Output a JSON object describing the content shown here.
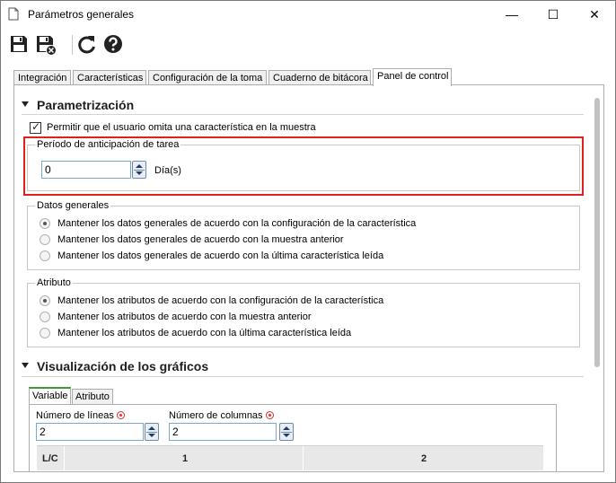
{
  "window": {
    "title": "Parámetros generales",
    "controls": {
      "minimize": "—",
      "maximize": "☐",
      "close": "✕"
    }
  },
  "toolbar": {
    "buttons": [
      {
        "name": "save",
        "icon": "floppy-disk-icon"
      },
      {
        "name": "save-and-close",
        "icon": "floppy-disk-close-icon"
      },
      {
        "name": "refresh",
        "icon": "refresh-icon"
      },
      {
        "name": "help",
        "icon": "help-icon"
      }
    ]
  },
  "tabs": [
    {
      "label": "Integración"
    },
    {
      "label": "Características"
    },
    {
      "label": "Configuración de la toma"
    },
    {
      "label": "Cuaderno de bitácora"
    },
    {
      "label": "Panel de control",
      "active": true
    }
  ],
  "parametrizacion": {
    "title": "Parametrización",
    "allow_omit": {
      "label": "Permitir que el usuario omita una característica en la muestra",
      "checked": true
    },
    "periodo": {
      "legend": "Período de anticipación de tarea",
      "value": "0",
      "unit": "Día(s)"
    },
    "datos_generales": {
      "legend": "Datos generales",
      "options": [
        {
          "label": "Mantener los datos generales de acuerdo con la configuración de la característica",
          "selected": true
        },
        {
          "label": "Mantener los datos generales de acuerdo con la muestra anterior",
          "selected": false
        },
        {
          "label": "Mantener los datos generales de acuerdo con la última característica leída",
          "selected": false
        }
      ]
    },
    "atributo": {
      "legend": "Atributo",
      "options": [
        {
          "label": "Mantener los atributos de acuerdo con la configuración de la característica",
          "selected": true
        },
        {
          "label": "Mantener los atributos de acuerdo con la muestra anterior",
          "selected": false
        },
        {
          "label": "Mantener los atributos de acuerdo con la última característica leída",
          "selected": false
        }
      ]
    }
  },
  "visualizacion": {
    "title": "Visualización de los gráficos",
    "subtabs": [
      {
        "label": "Variable",
        "active": true
      },
      {
        "label": "Atributo"
      }
    ],
    "lineas": {
      "label": "Número de líneas",
      "value": "2"
    },
    "columnas": {
      "label": "Número de columnas",
      "value": "2"
    },
    "grid_header": {
      "corner": "L/C",
      "col1": "1",
      "col2": "2"
    }
  },
  "colors": {
    "highlight": "#e0201c",
    "active_subtab": "#3c9a3c",
    "required": "#e03030"
  }
}
